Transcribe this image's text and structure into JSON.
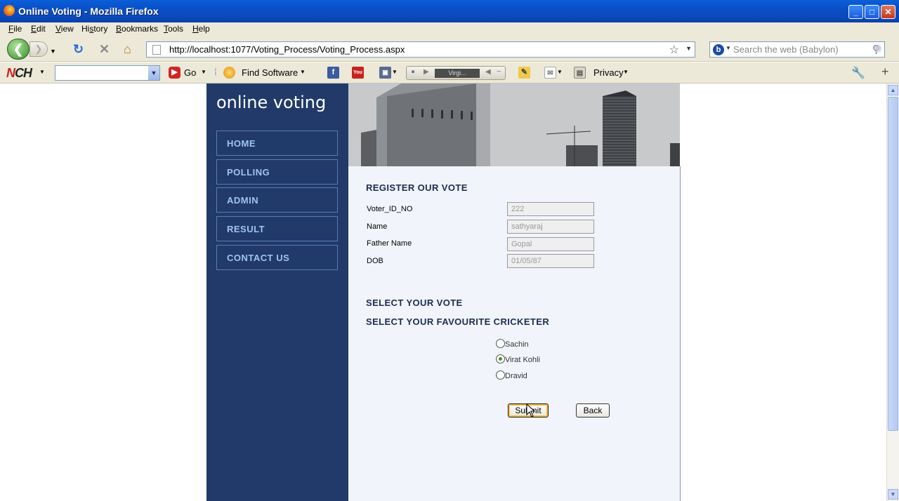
{
  "window": {
    "title": "Online Voting - Mozilla Firefox",
    "min_label": "_",
    "max_label": "□",
    "close_label": "✕"
  },
  "menu": [
    "File",
    "Edit",
    "View",
    "History",
    "Bookmarks",
    "Tools",
    "Help"
  ],
  "nav": {
    "url": "http://localhost:1077/Voting_Process/Voting_Process.aspx",
    "search_placeholder": "Search the web (Babylon)"
  },
  "toolbar": {
    "go_label": "Go",
    "find_software_label": "Find Software",
    "player_text": "Virgi...",
    "privacy_label": "Privacy"
  },
  "site": {
    "title": "online voting",
    "nav": [
      "HOME",
      "POLLING",
      "ADMIN",
      "RESULT",
      "CONTACT US"
    ]
  },
  "form": {
    "heading": "REGISTER OUR VOTE",
    "fields": [
      {
        "label": "Voter_ID_NO",
        "value": "222"
      },
      {
        "label": "Name",
        "value": "sathyaraj"
      },
      {
        "label": "Father Name",
        "value": "Gopal"
      },
      {
        "label": "DOB",
        "value": "01/05/87"
      }
    ],
    "vote_heading": "SELECT YOUR VOTE",
    "cricketer_heading": "SELECT YOUR FAVOURITE CRICKETER",
    "options": [
      {
        "label": "Sachin",
        "checked": false
      },
      {
        "label": "Virat Kohli",
        "checked": true
      },
      {
        "label": "Dravid",
        "checked": false
      }
    ],
    "submit_label": "Submit",
    "back_label": "Back"
  }
}
